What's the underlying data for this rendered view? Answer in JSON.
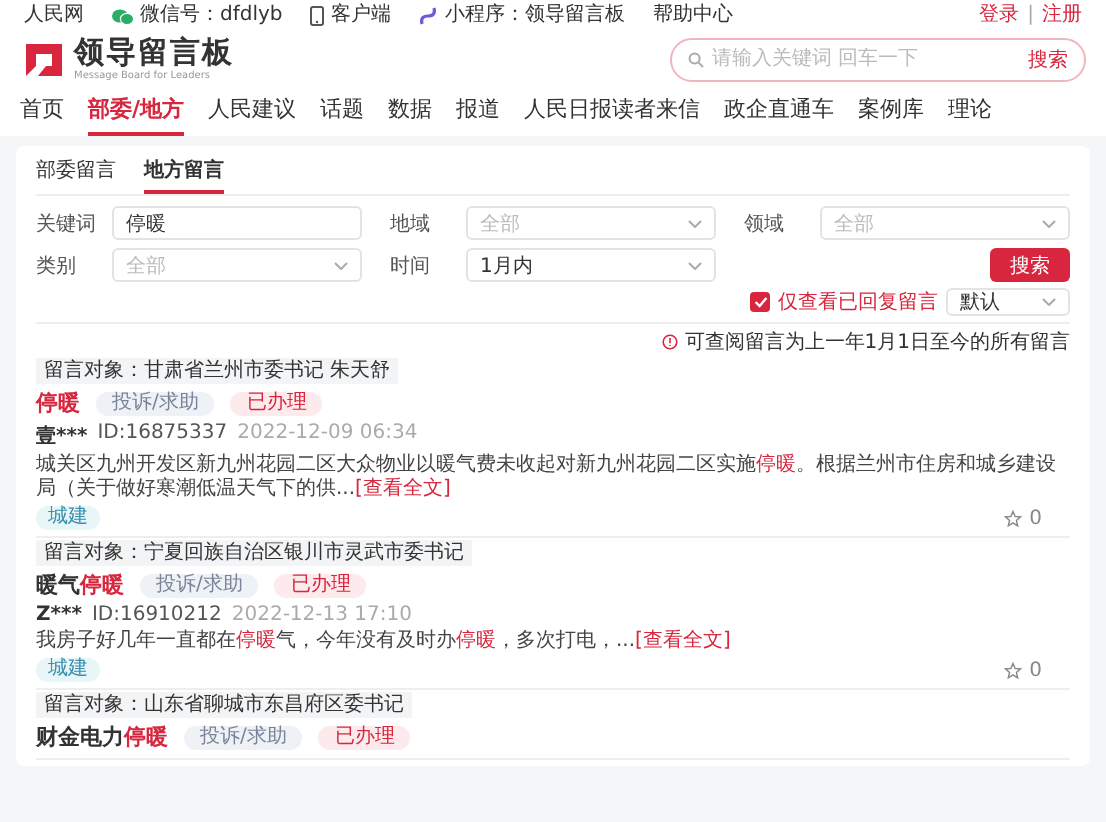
{
  "top_bar": {
    "site": "人民网",
    "wechat": "微信号：dfdlyb",
    "app": "客户端",
    "mini_program": "小程序：领导留言板",
    "help": "帮助中心",
    "login": "登录",
    "separator": "|",
    "register": "注册"
  },
  "header": {
    "logo_title": "领导留言板",
    "logo_subtitle": "Message Board for Leaders",
    "search": {
      "placeholder": "请输入关键词 回车一下",
      "button": "搜索"
    }
  },
  "nav": [
    {
      "label": "首页",
      "selected": false
    },
    {
      "label": "部委/地方",
      "selected": true
    },
    {
      "label": "人民建议",
      "selected": false
    },
    {
      "label": "话题",
      "selected": false
    },
    {
      "label": "数据",
      "selected": false
    },
    {
      "label": "报道",
      "selected": false
    },
    {
      "label": "人民日报读者来信",
      "selected": false
    },
    {
      "label": "政企直通车",
      "selected": false
    },
    {
      "label": "案例库",
      "selected": false
    },
    {
      "label": "理论",
      "selected": false
    }
  ],
  "tabs": [
    {
      "label": "部委留言",
      "selected": false
    },
    {
      "label": "地方留言",
      "selected": true
    }
  ],
  "filters": [
    {
      "kind": "text",
      "label": "关键词",
      "value": "停暖"
    },
    {
      "kind": "select",
      "label": "地域",
      "placeholder": "全部"
    },
    {
      "kind": "select",
      "label": "领域",
      "placeholder": "全部"
    },
    {
      "kind": "select",
      "label": "类别",
      "placeholder": "全部"
    },
    {
      "kind": "select",
      "label": "时间",
      "value": "1月内"
    }
  ],
  "search_button": "搜索",
  "replied_only": {
    "label": "仅查看已回复留言",
    "checked": true
  },
  "sort": {
    "value": "默认"
  },
  "notice": "可查阅留言为上一年1月1日至今的所有留言",
  "posts": [
    {
      "target": "留言对象：甘肃省兰州市委书记 朱天舒",
      "title": [
        {
          "text": "停暖",
          "highlight": true
        }
      ],
      "type": "投诉/求助",
      "status": "已办理",
      "user": "壹***",
      "id": "ID:16875337",
      "date": "2022-12-09 06:34",
      "body": [
        {
          "text": "城关区九州开发区新九州花园二区大众物业以暖气费未收起对新九州花园二区实施",
          "highlight": false
        },
        {
          "text": "停暖",
          "highlight": true
        },
        {
          "text": "。根据兰州市住房和城乡建设局（关于做好寒潮低温天气下的供...",
          "highlight": false
        }
      ],
      "more": "[查看全文]",
      "tag": "城建",
      "likes": "0"
    },
    {
      "target": "留言对象：宁夏回族自治区银川市灵武市委书记",
      "title": [
        {
          "text": "暖气",
          "highlight": false
        },
        {
          "text": "停暖",
          "highlight": true
        }
      ],
      "type": "投诉/求助",
      "status": "已办理",
      "user": "Z***",
      "id": "ID:16910212",
      "date": "2022-12-13 17:10",
      "body": [
        {
          "text": "我房子好几年一直都在",
          "highlight": false
        },
        {
          "text": "停暖",
          "highlight": true
        },
        {
          "text": "气，今年没有及时办",
          "highlight": false
        },
        {
          "text": "停暖",
          "highlight": true
        },
        {
          "text": "，多次打电，...",
          "highlight": false
        }
      ],
      "more": "[查看全文]",
      "tag": "城建",
      "likes": "0"
    },
    {
      "target": "留言对象：山东省聊城市东昌府区委书记",
      "title": [
        {
          "text": "财金电力",
          "highlight": false
        },
        {
          "text": "停暖",
          "highlight": true
        }
      ],
      "type": "投诉/求助",
      "status": "已办理"
    }
  ]
}
